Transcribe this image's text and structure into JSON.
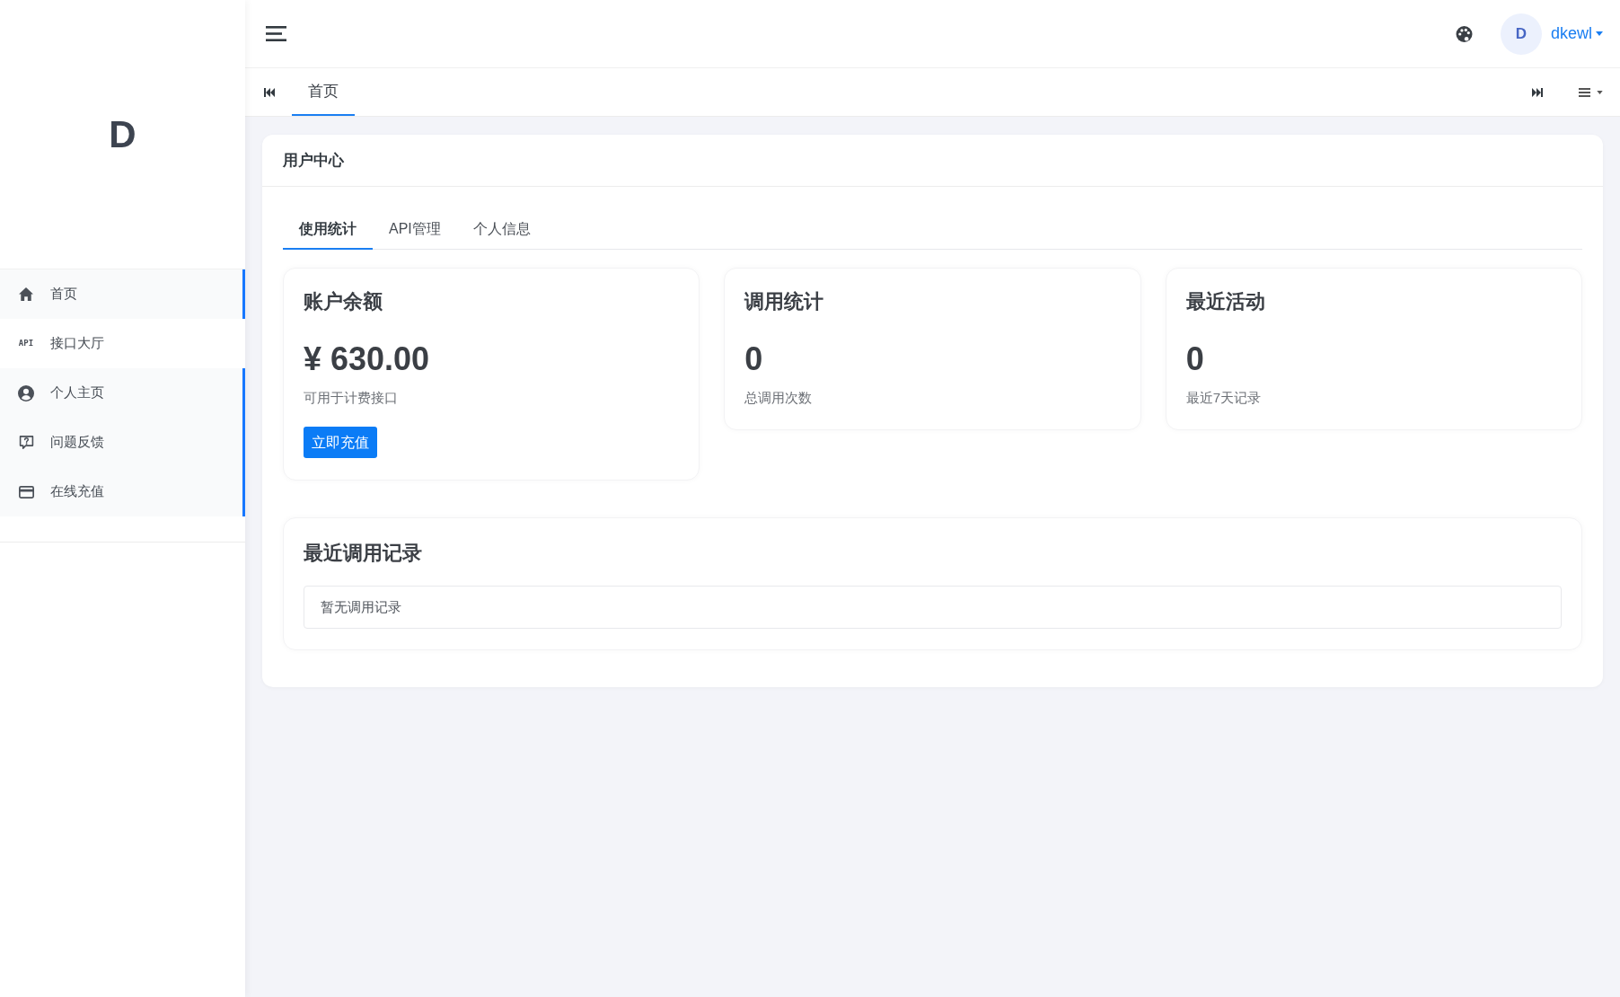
{
  "sidebar": {
    "logo": "D",
    "items": [
      {
        "label": "首页",
        "selected": true
      },
      {
        "label": "接口大厅",
        "icon_text": "API",
        "selected": false
      },
      {
        "label": "个人主页",
        "selected": true
      },
      {
        "label": "问题反馈",
        "selected": true
      },
      {
        "label": "在线充值",
        "selected": true
      }
    ]
  },
  "header": {
    "user": {
      "avatar": "D",
      "name": "dkewl"
    }
  },
  "page_tabs": [
    {
      "label": "首页",
      "selected": true
    }
  ],
  "panel": {
    "title": "用户中心",
    "tabs": [
      {
        "label": "使用统计",
        "selected": true
      },
      {
        "label": "API管理",
        "selected": false
      },
      {
        "label": "个人信息",
        "selected": false
      }
    ],
    "stats": [
      {
        "title": "账户余额",
        "value": "¥ 630.00",
        "caption": "可用于计费接口",
        "action": "立即充值"
      },
      {
        "title": "调用统计",
        "value": "0",
        "caption": "总调用次数"
      },
      {
        "title": "最近活动",
        "value": "0",
        "caption": "最近7天记录"
      }
    ],
    "recent_calls": {
      "title": "最近调用记录",
      "empty_text": "暂无调用记录"
    }
  }
}
